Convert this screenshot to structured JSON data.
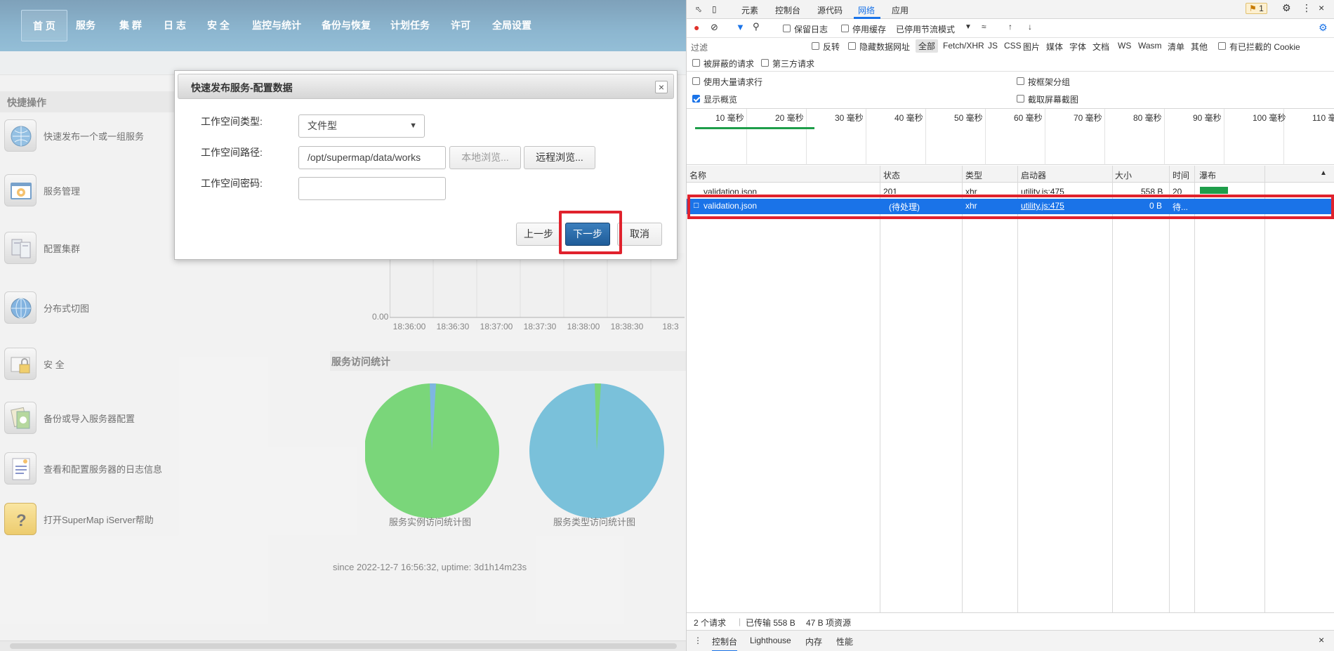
{
  "nav": {
    "items": [
      "首 页",
      "服务",
      "集 群",
      "日 志",
      "安 全",
      "监控与统计",
      "备份与恢复",
      "计划任务",
      "许可",
      "全局设置"
    ]
  },
  "quick": {
    "title": "快捷操作",
    "items": [
      {
        "label": "快速发布一个或一组服务",
        "icon": "globe-publish-icon"
      },
      {
        "label": "服务管理",
        "icon": "gear-window-icon"
      },
      {
        "label": "配置集群",
        "icon": "servers-icon"
      },
      {
        "label": "分布式切图",
        "icon": "globe-icon"
      },
      {
        "label": "安 全",
        "icon": "lock-icon"
      },
      {
        "label": "备份或导入服务器配置",
        "icon": "backup-icon"
      },
      {
        "label": "查看和配置服务器的日志信息",
        "icon": "log-document-icon"
      },
      {
        "label": "打开SuperMap iServer帮助",
        "icon": "help-icon"
      }
    ]
  },
  "monitor_chart": {
    "y_tick": "0.00",
    "x_ticks": [
      "18:36:00",
      "18:36:30",
      "18:37:00",
      "18:37:30",
      "18:38:00",
      "18:38:30",
      "18:3"
    ]
  },
  "service_stats": {
    "title": "服务访问统计",
    "pies": [
      {
        "label": "服务实例访问统计图",
        "main_color": "#33c133",
        "sliver_color": "#3a8fd1",
        "sliver_fraction": 0.01
      },
      {
        "label": "服务类型访问统计图",
        "main_color": "#34a0c7",
        "sliver_color": "#33c133",
        "sliver_fraction": 0.01
      }
    ]
  },
  "since": "since 2022-12-7 16:56:32, uptime: 3d1h14m23s",
  "dialog": {
    "title": "快速发布服务-配置数据",
    "close": "×",
    "workspace_type_label": "工作空间类型:",
    "workspace_type_value": "文件型",
    "workspace_path_label": "工作空间路径:",
    "workspace_path_value": "/opt/supermap/data/works",
    "local_browse": "本地浏览...",
    "remote_browse": "远程浏览...",
    "workspace_password_label": "工作空间密码:",
    "prev": "上一步",
    "next": "下一步",
    "cancel": "取消"
  },
  "devtools": {
    "tabs": [
      "元素",
      "控制台",
      "源代码",
      "网络",
      "应用"
    ],
    "active_tab": "网络",
    "issues_badge": "1",
    "toolbar": {
      "preserve_log": "保留日志",
      "disable_cache": "停用缓存",
      "throttle": "已停用节流模式"
    },
    "filter": {
      "placeholder": "过滤",
      "invert": "反转",
      "hide_data_urls": "隐藏数据网址",
      "types": [
        "全部",
        "Fetch/XHR",
        "JS",
        "CSS",
        "图片",
        "媒体",
        "字体",
        "文档",
        "WS",
        "Wasm",
        "清单",
        "其他"
      ],
      "blocked_cookies": "有已拦截的 Cookie",
      "blocked_requests": "被屏蔽的请求",
      "third_party": "第三方请求"
    },
    "options": {
      "large_rows": "使用大量请求行",
      "group_by_frame": "按框架分组",
      "show_overview": "显示概览",
      "capture_screenshots": "截取屏幕截图"
    },
    "timeline_labels": [
      "10 毫秒",
      "20 毫秒",
      "30 毫秒",
      "40 毫秒",
      "50 毫秒",
      "60 毫秒",
      "70 毫秒",
      "80 毫秒",
      "90 毫秒",
      "100 毫秒",
      "110 毫"
    ],
    "columns": [
      "名称",
      "状态",
      "类型",
      "启动器",
      "大小",
      "时间",
      "瀑布"
    ],
    "rows": [
      {
        "name": "validation.json",
        "status": "201",
        "type": "xhr",
        "initiator": "utility.js:475",
        "size": "558 B",
        "time": "20"
      },
      {
        "name": "validation.json",
        "status": "(待处理)",
        "type": "xhr",
        "initiator": "utility.js:475",
        "size": "0 B",
        "time": "待..."
      }
    ],
    "status_bar": {
      "requests": "2 个请求",
      "transferred": "已传输 558 B",
      "resources": "47 B 项资源"
    },
    "drawer_tabs": [
      "控制台",
      "Lighthouse",
      "内存",
      "性能"
    ]
  },
  "colors": {
    "nav_bg": "#4f8fb6",
    "devtools_accent": "#1a73e8",
    "highlight_red": "#e0222d"
  }
}
